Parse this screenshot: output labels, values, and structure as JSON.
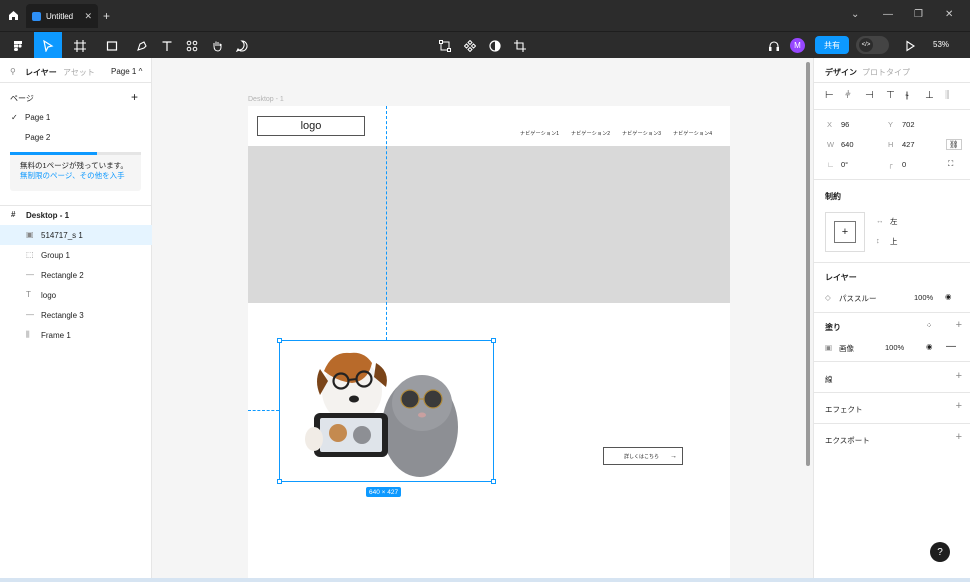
{
  "titlebar": {
    "tab_title": "Untitled",
    "tab_close": "✕",
    "new_tab": "+",
    "minimize": "—",
    "restore": "❐",
    "close": "✕",
    "menu": "⌄"
  },
  "toolbar": {
    "share_label": "共有",
    "avatar_initial": "M",
    "zoom": "53%",
    "dev_mode": "</>"
  },
  "left_panel": {
    "tabs": [
      "レイヤー",
      "アセット"
    ],
    "page_selector": "Page 1 ^",
    "pages_title": "ページ",
    "add": "+",
    "pages": [
      "Page 1",
      "Page 2"
    ],
    "checkmark": "✓",
    "upsell_text": "無料の1ページが残っています。",
    "upsell_link": "無制限のページ、その他を入手",
    "layers": [
      {
        "name": "Desktop - 1",
        "icon": "#"
      },
      {
        "name": "514717_s 1",
        "icon": "▣"
      },
      {
        "name": "Group 1",
        "icon": "⬚"
      },
      {
        "name": "Rectangle 2",
        "icon": "—"
      },
      {
        "name": "logo",
        "icon": "T"
      },
      {
        "name": "Rectangle 3",
        "icon": "—"
      },
      {
        "name": "Frame 1",
        "icon": "⫼"
      }
    ]
  },
  "canvas": {
    "frame_label": "Desktop - 1",
    "logo_text": "logo",
    "nav": [
      "ナビゲーション1",
      "ナビゲーション2",
      "ナビゲーション3",
      "ナビゲーション4"
    ],
    "button_text": "詳しくはこちら",
    "button_arrow": "→",
    "dimension_badge": "640 × 427"
  },
  "right_panel": {
    "tabs": [
      "デザイン",
      "プロトタイプ"
    ],
    "x_label": "X",
    "x": "96",
    "y_label": "Y",
    "y": "702",
    "w_label": "W",
    "w": "640",
    "h_label": "H",
    "h": "427",
    "rotation": "0°",
    "radius": "0",
    "constraints_title": "制約",
    "constraint_h": "左",
    "constraint_v": "上",
    "layer_title": "レイヤー",
    "blend_mode": "パススルー",
    "layer_opacity": "100%",
    "fill_title": "塗り",
    "fill_type": "画像",
    "fill_opacity": "100%",
    "stroke_title": "線",
    "effects_title": "エフェクト",
    "export_title": "エクスポート"
  },
  "help": "?"
}
